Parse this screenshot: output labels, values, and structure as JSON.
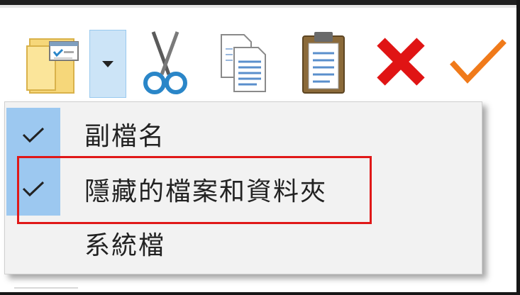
{
  "toolbar": {
    "buttons": [
      {
        "name": "show-hide-split-button",
        "icon": "folder-options-icon"
      },
      {
        "name": "show-hide-dropdown-arrow",
        "icon": "chevron-down-icon"
      },
      {
        "name": "cut-button",
        "icon": "scissors-icon"
      },
      {
        "name": "copy-button",
        "icon": "copy-icon"
      },
      {
        "name": "paste-button",
        "icon": "clipboard-icon"
      },
      {
        "name": "delete-button",
        "icon": "delete-x-icon"
      },
      {
        "name": "rename-button",
        "icon": "checkmark-icon"
      }
    ]
  },
  "menu": {
    "items": [
      {
        "label": "副檔名",
        "checked": true
      },
      {
        "label": "隱藏的檔案和資料夾",
        "checked": true
      },
      {
        "label": "系統檔",
        "checked": false
      }
    ]
  },
  "colors": {
    "check_bg": "#9cc8f0",
    "highlight_border": "#e01818",
    "scissors": "#2a86c8",
    "delete": "#e01414",
    "checkmark": "#f07a1a"
  }
}
